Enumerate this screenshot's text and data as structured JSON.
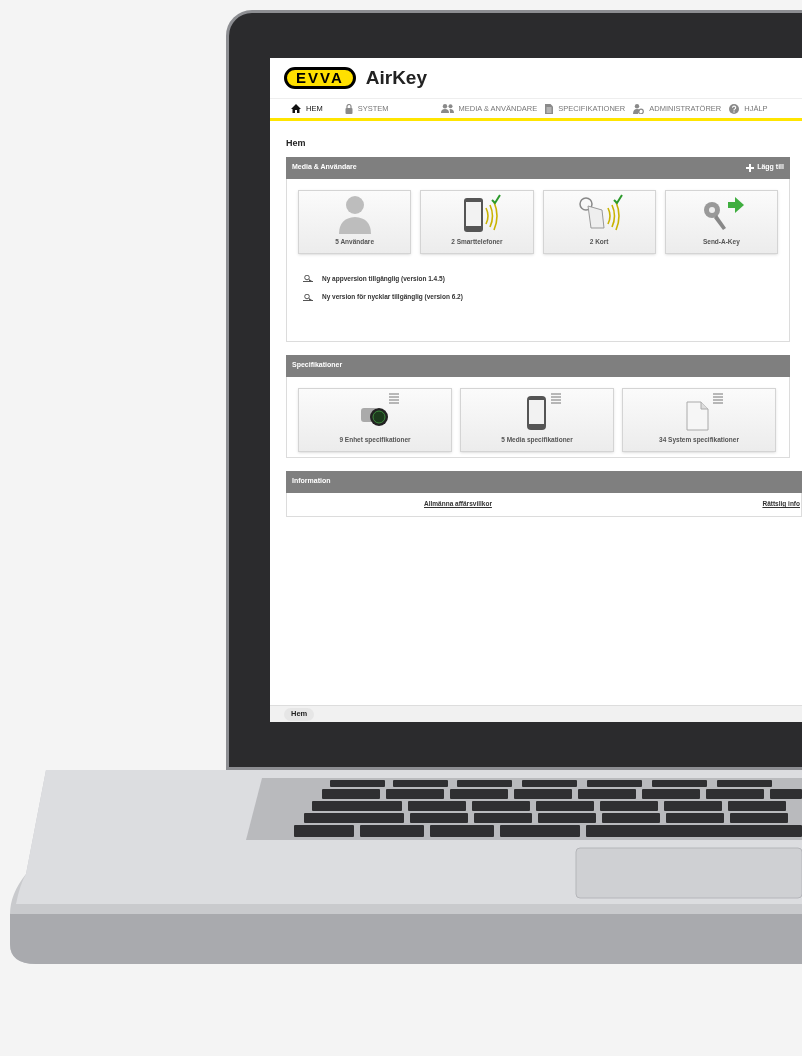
{
  "app": {
    "brand": "EVVA",
    "product": "AirKey"
  },
  "nav": [
    {
      "label": "HEM",
      "kind": "home",
      "selected": true
    },
    {
      "label": "SYSTEM",
      "kind": "lock",
      "selected": false
    },
    {
      "label": "MEDIA & ANVÄNDARE",
      "kind": "users",
      "selected": false
    },
    {
      "label": "SPECIFIKATIONER",
      "kind": "document",
      "selected": false
    },
    {
      "label": "ADMINISTRATÖRER",
      "kind": "admin",
      "selected": false
    },
    {
      "label": "HJÄLP",
      "kind": "help",
      "selected": false
    }
  ],
  "page_title": "Hem",
  "media_section": {
    "title": "Media & Användare",
    "add_button": "Lägg till",
    "tiles": [
      {
        "label": "5 Användare",
        "kind": "user"
      },
      {
        "label": "2 Smarttelefoner",
        "kind": "phone"
      },
      {
        "label": "2 Kort",
        "kind": "card"
      },
      {
        "label": "Send-A-Key",
        "kind": "key"
      }
    ],
    "notices": [
      "Ny appversion tillgänglig (version 1.4.5)",
      "Ny version för nycklar tillgänglig (version 6.2)"
    ]
  },
  "specs_section": {
    "title": "Specifikationer",
    "tiles": [
      {
        "label": "9 Enhet specifikationer",
        "kind": "cylinder"
      },
      {
        "label": "5 Media specifikationer",
        "kind": "phone"
      },
      {
        "label": "34 System specifikationer",
        "kind": "document"
      }
    ]
  },
  "info_section": {
    "title": "Information",
    "links": [
      "Allmänna affärsvillkor",
      "Rättslig info"
    ]
  },
  "footer": {
    "breadcrumb": "Hem"
  }
}
